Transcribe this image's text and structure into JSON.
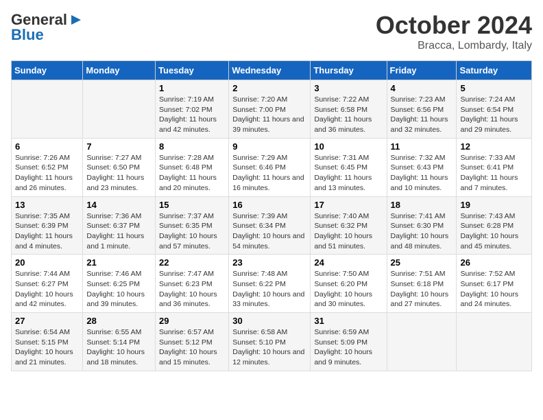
{
  "header": {
    "logo_general": "General",
    "logo_blue": "Blue",
    "month": "October 2024",
    "location": "Bracca, Lombardy, Italy"
  },
  "days_of_week": [
    "Sunday",
    "Monday",
    "Tuesday",
    "Wednesday",
    "Thursday",
    "Friday",
    "Saturday"
  ],
  "weeks": [
    [
      {
        "day": "",
        "content": ""
      },
      {
        "day": "",
        "content": ""
      },
      {
        "day": "1",
        "content": "Sunrise: 7:19 AM\nSunset: 7:02 PM\nDaylight: 11 hours and 42 minutes."
      },
      {
        "day": "2",
        "content": "Sunrise: 7:20 AM\nSunset: 7:00 PM\nDaylight: 11 hours and 39 minutes."
      },
      {
        "day": "3",
        "content": "Sunrise: 7:22 AM\nSunset: 6:58 PM\nDaylight: 11 hours and 36 minutes."
      },
      {
        "day": "4",
        "content": "Sunrise: 7:23 AM\nSunset: 6:56 PM\nDaylight: 11 hours and 32 minutes."
      },
      {
        "day": "5",
        "content": "Sunrise: 7:24 AM\nSunset: 6:54 PM\nDaylight: 11 hours and 29 minutes."
      }
    ],
    [
      {
        "day": "6",
        "content": "Sunrise: 7:26 AM\nSunset: 6:52 PM\nDaylight: 11 hours and 26 minutes."
      },
      {
        "day": "7",
        "content": "Sunrise: 7:27 AM\nSunset: 6:50 PM\nDaylight: 11 hours and 23 minutes."
      },
      {
        "day": "8",
        "content": "Sunrise: 7:28 AM\nSunset: 6:48 PM\nDaylight: 11 hours and 20 minutes."
      },
      {
        "day": "9",
        "content": "Sunrise: 7:29 AM\nSunset: 6:46 PM\nDaylight: 11 hours and 16 minutes."
      },
      {
        "day": "10",
        "content": "Sunrise: 7:31 AM\nSunset: 6:45 PM\nDaylight: 11 hours and 13 minutes."
      },
      {
        "day": "11",
        "content": "Sunrise: 7:32 AM\nSunset: 6:43 PM\nDaylight: 11 hours and 10 minutes."
      },
      {
        "day": "12",
        "content": "Sunrise: 7:33 AM\nSunset: 6:41 PM\nDaylight: 11 hours and 7 minutes."
      }
    ],
    [
      {
        "day": "13",
        "content": "Sunrise: 7:35 AM\nSunset: 6:39 PM\nDaylight: 11 hours and 4 minutes."
      },
      {
        "day": "14",
        "content": "Sunrise: 7:36 AM\nSunset: 6:37 PM\nDaylight: 11 hours and 1 minute."
      },
      {
        "day": "15",
        "content": "Sunrise: 7:37 AM\nSunset: 6:35 PM\nDaylight: 10 hours and 57 minutes."
      },
      {
        "day": "16",
        "content": "Sunrise: 7:39 AM\nSunset: 6:34 PM\nDaylight: 10 hours and 54 minutes."
      },
      {
        "day": "17",
        "content": "Sunrise: 7:40 AM\nSunset: 6:32 PM\nDaylight: 10 hours and 51 minutes."
      },
      {
        "day": "18",
        "content": "Sunrise: 7:41 AM\nSunset: 6:30 PM\nDaylight: 10 hours and 48 minutes."
      },
      {
        "day": "19",
        "content": "Sunrise: 7:43 AM\nSunset: 6:28 PM\nDaylight: 10 hours and 45 minutes."
      }
    ],
    [
      {
        "day": "20",
        "content": "Sunrise: 7:44 AM\nSunset: 6:27 PM\nDaylight: 10 hours and 42 minutes."
      },
      {
        "day": "21",
        "content": "Sunrise: 7:46 AM\nSunset: 6:25 PM\nDaylight: 10 hours and 39 minutes."
      },
      {
        "day": "22",
        "content": "Sunrise: 7:47 AM\nSunset: 6:23 PM\nDaylight: 10 hours and 36 minutes."
      },
      {
        "day": "23",
        "content": "Sunrise: 7:48 AM\nSunset: 6:22 PM\nDaylight: 10 hours and 33 minutes."
      },
      {
        "day": "24",
        "content": "Sunrise: 7:50 AM\nSunset: 6:20 PM\nDaylight: 10 hours and 30 minutes."
      },
      {
        "day": "25",
        "content": "Sunrise: 7:51 AM\nSunset: 6:18 PM\nDaylight: 10 hours and 27 minutes."
      },
      {
        "day": "26",
        "content": "Sunrise: 7:52 AM\nSunset: 6:17 PM\nDaylight: 10 hours and 24 minutes."
      }
    ],
    [
      {
        "day": "27",
        "content": "Sunrise: 6:54 AM\nSunset: 5:15 PM\nDaylight: 10 hours and 21 minutes."
      },
      {
        "day": "28",
        "content": "Sunrise: 6:55 AM\nSunset: 5:14 PM\nDaylight: 10 hours and 18 minutes."
      },
      {
        "day": "29",
        "content": "Sunrise: 6:57 AM\nSunset: 5:12 PM\nDaylight: 10 hours and 15 minutes."
      },
      {
        "day": "30",
        "content": "Sunrise: 6:58 AM\nSunset: 5:10 PM\nDaylight: 10 hours and 12 minutes."
      },
      {
        "day": "31",
        "content": "Sunrise: 6:59 AM\nSunset: 5:09 PM\nDaylight: 10 hours and 9 minutes."
      },
      {
        "day": "",
        "content": ""
      },
      {
        "day": "",
        "content": ""
      }
    ]
  ]
}
